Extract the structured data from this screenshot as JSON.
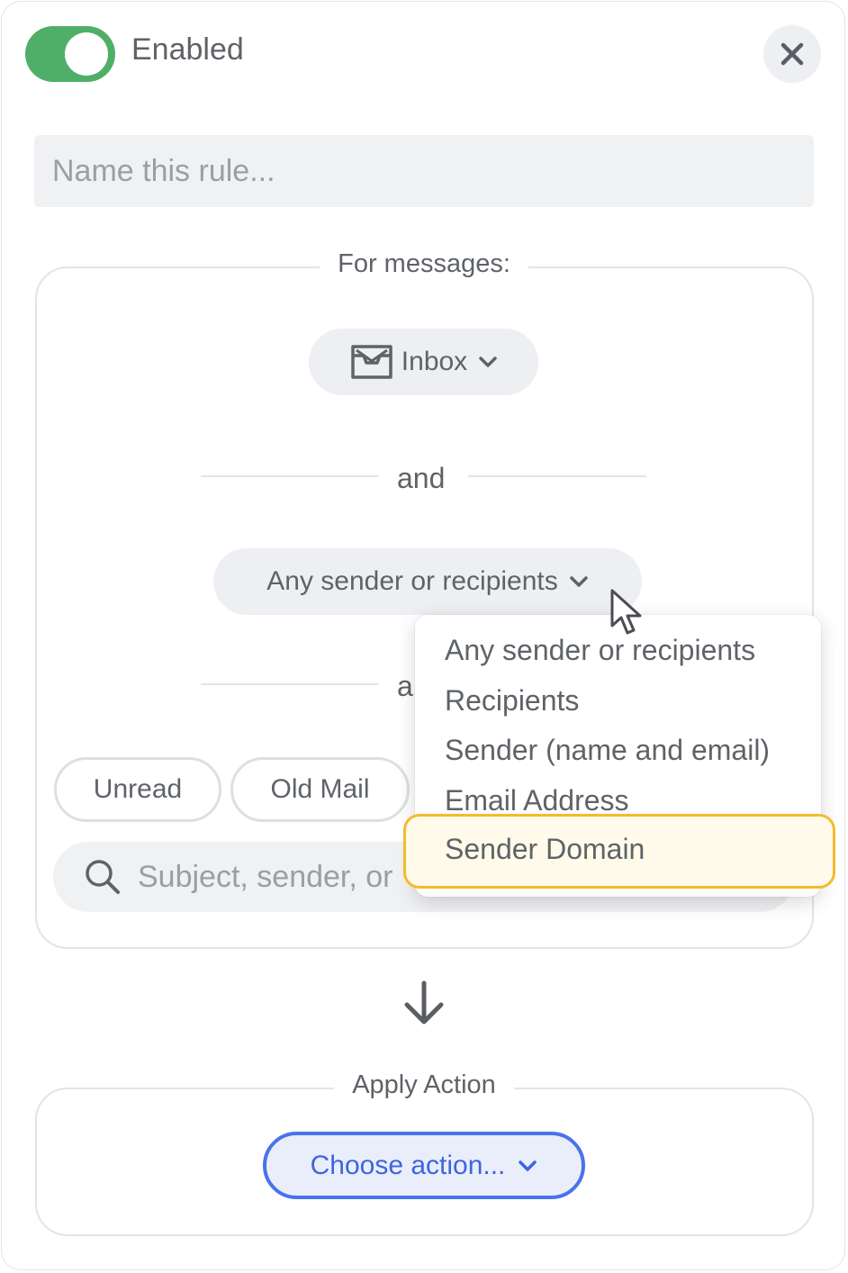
{
  "header": {
    "toggle_label": "Enabled",
    "toggle_on": true,
    "close_icon": "close-icon"
  },
  "name_input": {
    "placeholder": "Name this rule..."
  },
  "for_messages": {
    "legend": "For messages:",
    "mailbox_label": "Inbox",
    "mailbox_icon": "inbox-icon",
    "and_label_1": "and",
    "sender_filter_label": "Any sender or recipients",
    "and_label_2": "a",
    "chips": [
      "Unread",
      "Old Mail"
    ],
    "search_placeholder": "Subject, sender, or"
  },
  "dropdown": {
    "items": [
      "Any sender or recipients",
      "Recipients",
      "Sender (name and email)",
      "Email Address",
      "Sender Domain"
    ],
    "highlighted_index": 4
  },
  "apply_action": {
    "legend": "Apply Action",
    "button_label": "Choose action..."
  },
  "colors": {
    "toggle_on": "#4faf68",
    "accent_blue": "#4a72ea",
    "highlight_border": "#f2bc2b"
  }
}
